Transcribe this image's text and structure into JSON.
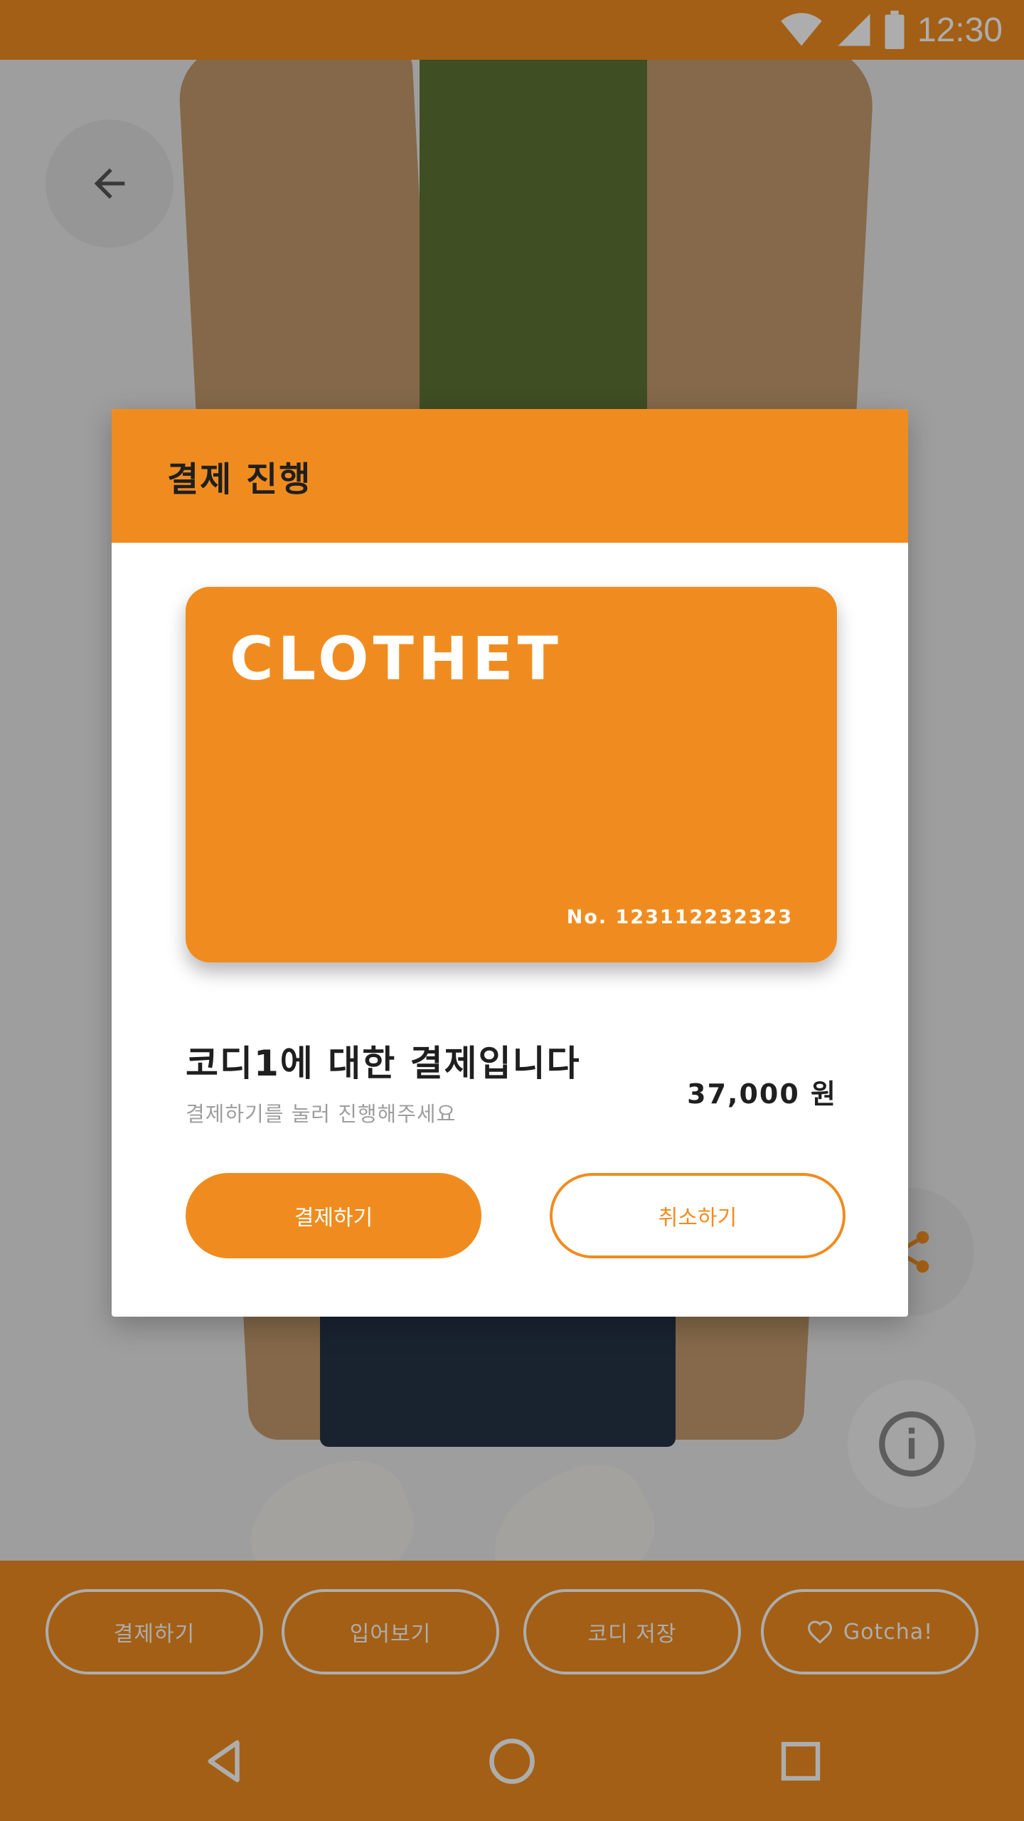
{
  "status_bar": {
    "time": "12:30",
    "icons": [
      "wifi-icon",
      "signal-icon",
      "battery-icon"
    ]
  },
  "background": {
    "back_button_icon": "arrow-left-icon",
    "share_button_icon": "share-icon",
    "info_button_icon": "info-icon"
  },
  "dialog": {
    "title": "결제 진행",
    "card": {
      "brand": "CLOTHET",
      "number": "No. 123112232323"
    },
    "payment_title": "코디1에 대한 결제입니다",
    "payment_subtitle": "결제하기를 눌러 진행해주세요",
    "amount": "37,000 원",
    "confirm_label": "결제하기",
    "cancel_label": "취소하기"
  },
  "action_bar": {
    "pay_label": "결제하기",
    "try_on_label": "입어보기",
    "save_outfit_label": "코디 저장",
    "gotcha_label": "Gotcha!",
    "gotcha_icon": "heart-icon"
  },
  "nav_bar": {
    "icons": [
      "back-triangle-icon",
      "home-circle-icon",
      "recents-square-icon"
    ]
  },
  "colors": {
    "accent": "#f08c1f",
    "text_dark": "#1f1f1f",
    "text_muted": "#9e9e9e"
  }
}
